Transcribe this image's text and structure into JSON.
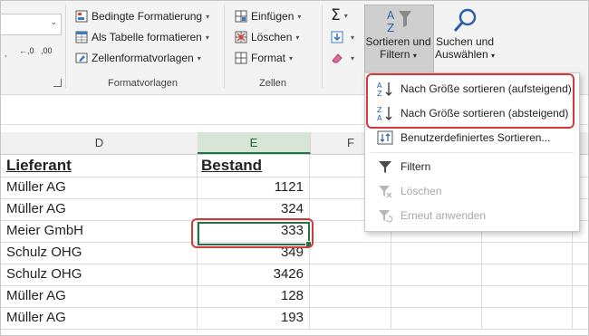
{
  "ribbon": {
    "number_format_buttons": [
      "←,0",
      ",00",
      "→,0"
    ],
    "formatvorlagen": {
      "items": [
        "Bedingte Formatierung",
        "Als Tabelle formatieren",
        "Zellenformatvorlagen"
      ],
      "group_label": "Formatvorlagen"
    },
    "zellen": {
      "items": [
        "Einfügen",
        "Löschen",
        "Format"
      ],
      "group_label": "Zellen"
    },
    "sort_filter": {
      "line1": "Sortieren und",
      "line2": "Filtern"
    },
    "find_select": {
      "line1": "Suchen und",
      "line2": "Auswählen"
    },
    "sigma": "Σ"
  },
  "sheet": {
    "columns": [
      "D",
      "E",
      "F"
    ],
    "active_column": "E",
    "header": {
      "supplier": "Lieferant",
      "stock": "Bestand"
    },
    "rows": [
      {
        "supplier": "Müller AG",
        "stock": "1121"
      },
      {
        "supplier": "Müller AG",
        "stock": "324"
      },
      {
        "supplier": "Meier GmbH",
        "stock": "333"
      },
      {
        "supplier": "Schulz OHG",
        "stock": "349"
      },
      {
        "supplier": "Schulz OHG",
        "stock": "3426"
      },
      {
        "supplier": "Müller AG",
        "stock": "128"
      },
      {
        "supplier": "Müller AG",
        "stock": "193"
      }
    ],
    "selected_value": "333"
  },
  "menu": {
    "items": [
      {
        "label": "Nach Größe sortieren (aufsteigend)",
        "icon": "sort-ascending-icon",
        "enabled": true
      },
      {
        "label": "Nach Größe sortieren (absteigend)",
        "icon": "sort-descending-icon",
        "enabled": true
      },
      {
        "label": "Benutzerdefiniertes Sortieren...",
        "icon": "custom-sort-icon",
        "enabled": true
      },
      {
        "label": "Filtern",
        "icon": "filter-icon",
        "enabled": true
      },
      {
        "label": "Löschen",
        "icon": "clear-filter-icon",
        "enabled": false
      },
      {
        "label": "Erneut anwenden",
        "icon": "reapply-icon",
        "enabled": false
      }
    ]
  },
  "colors": {
    "accent_green": "#217346",
    "highlight_red": "#d23a3a"
  }
}
